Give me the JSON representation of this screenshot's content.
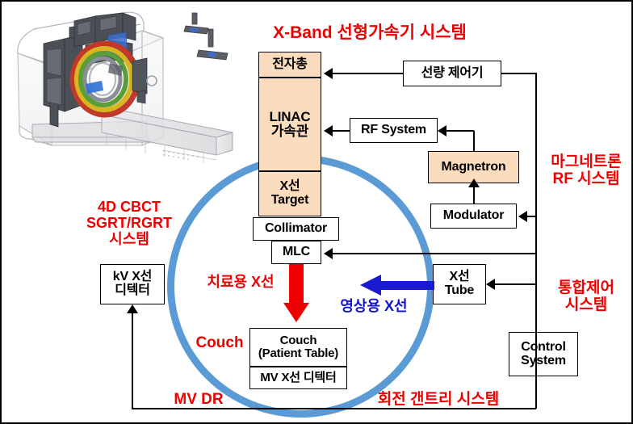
{
  "diagram": {
    "title_top": "X-Band 선형가속기 시스템",
    "label_magnetron_rf": "마그네트론\nRF 시스템",
    "label_integrated_control": "통합제어\n시스템",
    "label_cbct": "4D CBCT\nSGRT/RGRT\n시스템",
    "label_treatment_beam": "치료용 X선",
    "label_imaging_beam": "영상용 X선",
    "label_couch": "Couch",
    "label_mv_dr": "MV DR",
    "label_rotating_gantry": "회전 갠트리 시스템"
  },
  "boxes": {
    "electron_gun": "전자총",
    "linac": "LINAC\n가속관",
    "xray_target": "X선\nTarget",
    "collimator": "Collimator",
    "mlc": "MLC",
    "dose_controller": "선량 제어기",
    "rf_system": "RF System",
    "magnetron": "Magnetron",
    "modulator": "Modulator",
    "xray_tube": "X선\nTube",
    "control_system": "Control\nSystem",
    "kv_detector": "kV X선\n디텍터",
    "couch_table": "Couch\n(Patient Table)",
    "mv_detector": "MV X선 디텍터"
  },
  "colors": {
    "accent_red": "#ee0000",
    "accent_blue": "#1414cd",
    "gantry_blue": "#5b9bd5",
    "box_peach": "#fbdcbc",
    "line_black": "#000000"
  }
}
